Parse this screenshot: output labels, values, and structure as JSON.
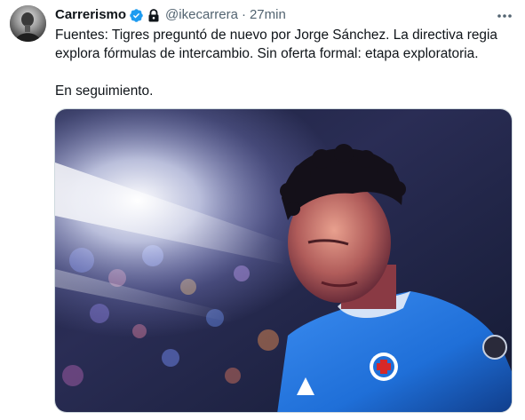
{
  "tweet": {
    "author": {
      "display_name": "Carrerismo",
      "handle": "@ikecarrera",
      "separator": "·",
      "time": "27min",
      "verified_color": "#1d9bf0"
    },
    "text": "Fuentes: Tigres preguntó de nuevo por Jorge Sánchez. La directiva regia\nexplora fórmulas de intercambio. Sin oferta formal: etapa exploratoria.\n\nEn seguimiento.",
    "media": {
      "type": "photo",
      "jersey_color": "#1f6fd8"
    },
    "icons": {
      "verified": "verified-badge-icon",
      "protected": "lock-icon",
      "more": "more-horizontal-icon"
    }
  }
}
